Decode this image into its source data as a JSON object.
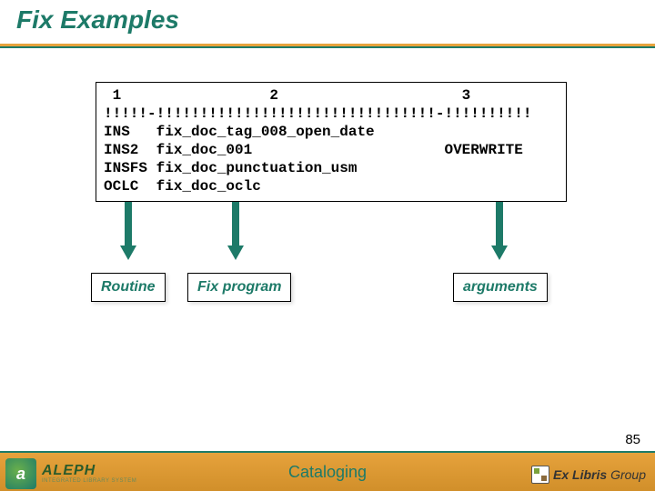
{
  "title": "Fix Examples",
  "code": {
    "header": " 1                 2                     3",
    "ruler": "!!!!!-!!!!!!!!!!!!!!!!!!!!!!!!!!!!!!!!-!!!!!!!!!!",
    "rows": [
      "INS   fix_doc_tag_008_open_date",
      "INS2  fix_doc_001                      OVERWRITE",
      "INSFS fix_doc_punctuation_usm",
      "OCLC  fix_doc_oclc"
    ]
  },
  "labels": {
    "routine": "Routine",
    "fixprog": "Fix program",
    "arguments": "arguments"
  },
  "footer": {
    "aleph_name": "ALEPH",
    "aleph_sub": "INTEGRATED LIBRARY SYSTEM",
    "center": "Cataloging",
    "exlibris": "Ex Libris",
    "exlibris_suffix": " Group"
  },
  "slide_number": "85"
}
